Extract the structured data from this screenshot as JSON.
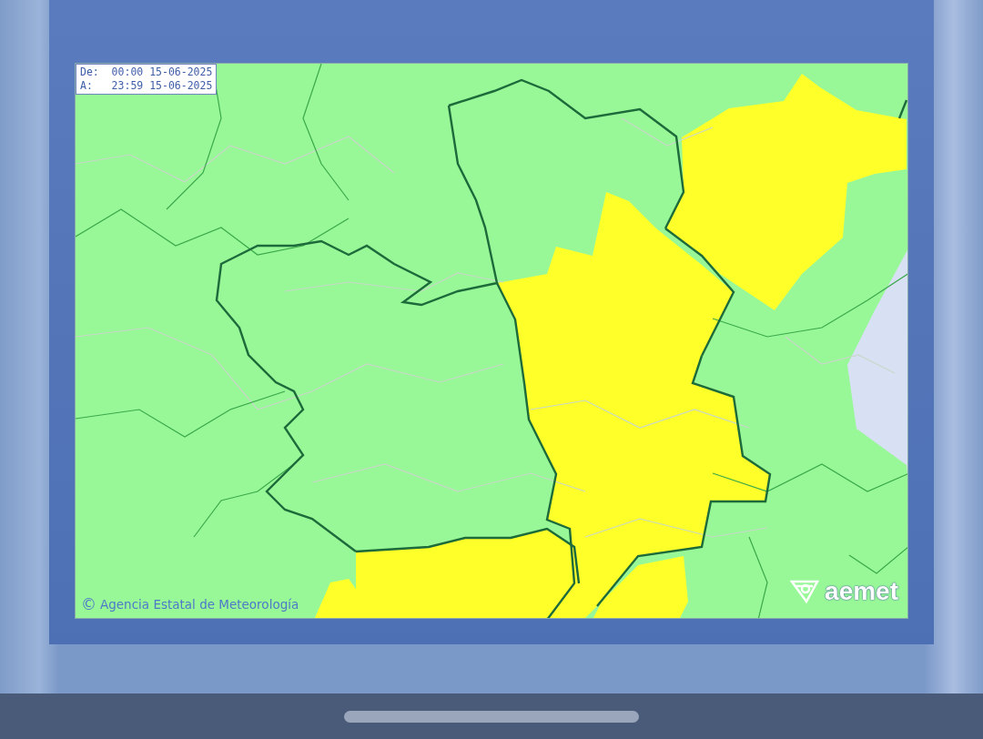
{
  "map": {
    "valid_from": "De:  00:00 15-06-2025",
    "valid_to": "A:   23:59 15-06-2025",
    "copyright_symbol": "©",
    "credit": "Agencia Estatal de Meteorología",
    "logo": "aemet"
  }
}
